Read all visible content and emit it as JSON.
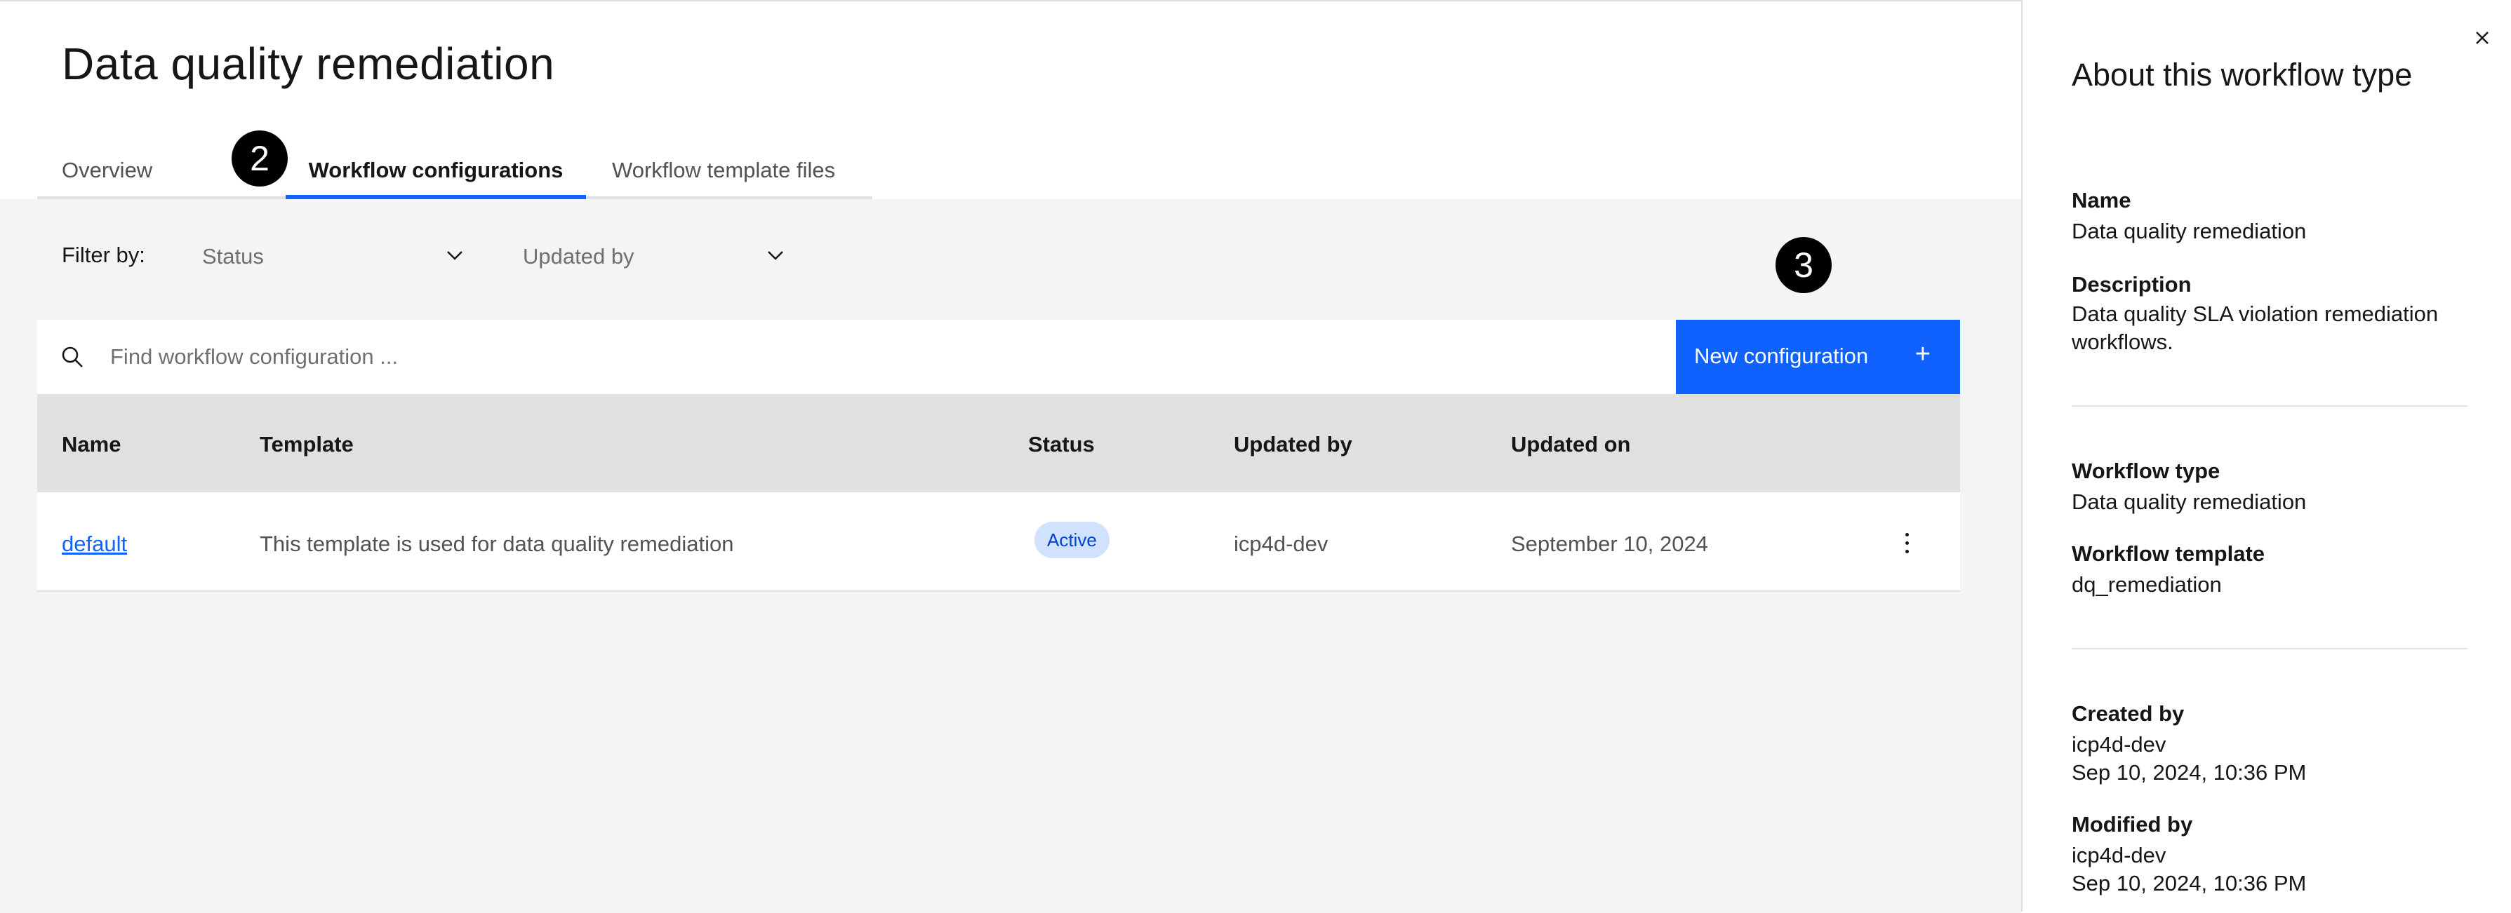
{
  "page": {
    "title": "Data quality remediation"
  },
  "tabs": [
    {
      "label": "Overview"
    },
    {
      "label": "Workflow configurations",
      "selected": true
    },
    {
      "label": "Workflow template files"
    }
  ],
  "callouts": {
    "tabs": "2",
    "new_button": "3"
  },
  "filters": {
    "label": "Filter by:",
    "status_placeholder": "Status",
    "updated_by_placeholder": "Updated by"
  },
  "search": {
    "placeholder": "Find workflow configuration ...",
    "value": ""
  },
  "toolbar": {
    "new_label": "New configuration",
    "new_icon": "add-icon"
  },
  "table": {
    "columns": [
      "Name",
      "Template",
      "Status",
      "Updated by",
      "Updated on"
    ],
    "rows": [
      {
        "name": "default",
        "template": "This template is used for data quality remediation",
        "status": "Active",
        "updated_by": "icp4d-dev",
        "updated_on": "September 10, 2024"
      }
    ]
  },
  "panel": {
    "title": "About this workflow type",
    "name_label": "Name",
    "name_value": "Data quality remediation",
    "description_label": "Description",
    "description_value": "Data quality SLA violation remediation workflows.",
    "workflow_type_label": "Workflow type",
    "workflow_type_value": "Data quality remediation",
    "workflow_template_label": "Workflow template",
    "workflow_template_value": "dq_remediation",
    "created_by_label": "Created by",
    "created_by_user": "icp4d-dev",
    "created_by_date": "Sep 10, 2024, 10:36 PM",
    "modified_by_label": "Modified by",
    "modified_by_user": "icp4d-dev",
    "modified_by_date": "Sep 10, 2024, 10:36 PM"
  },
  "colors": {
    "accent": "#0f62fe",
    "status_tag_bg": "#d0e2ff",
    "status_tag_text": "#0043ce",
    "content_bg": "#f4f4f4",
    "header_row_bg": "#e0e0e0"
  }
}
